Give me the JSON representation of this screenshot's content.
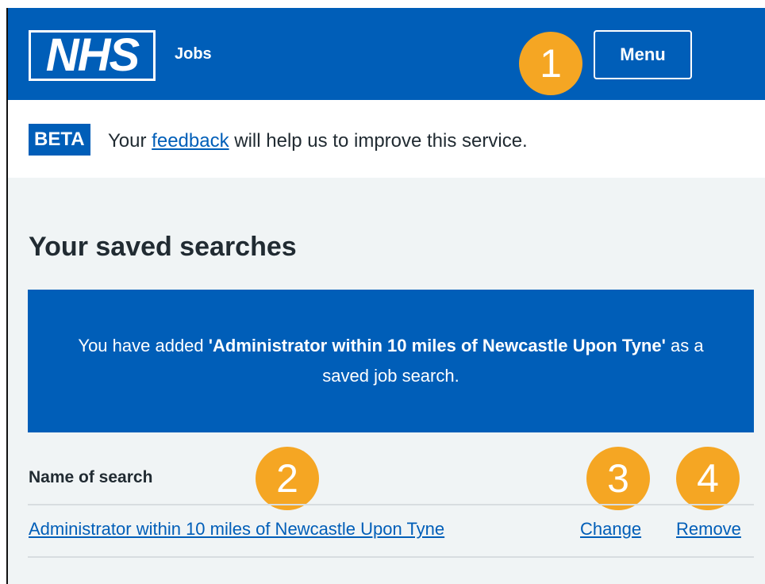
{
  "header": {
    "logo_text": "NHS",
    "service_name": "Jobs",
    "menu_label": "Menu"
  },
  "beta_banner": {
    "tag": "BETA",
    "text_before": "Your",
    "link_text": "feedback",
    "text_after": "will help us to improve this service."
  },
  "page": {
    "title": "Your saved searches"
  },
  "confirmation": {
    "text_before": "You have added",
    "search_name": "'Administrator within 10 miles of Newcastle Upon Tyne'",
    "text_after": "as a saved job search."
  },
  "saved_searches": {
    "column_header": "Name of search",
    "rows": [
      {
        "name": "Administrator within 10 miles of Newcastle Upon Tyne",
        "change_label": "Change",
        "remove_label": "Remove"
      }
    ]
  },
  "annotations": {
    "badge_1": "1",
    "badge_2": "2",
    "badge_3": "3",
    "badge_4": "4",
    "badge_color": "#f5a623"
  },
  "colors": {
    "nhs_blue": "#005eb8",
    "page_background": "#f0f4f5",
    "text": "#212b32"
  }
}
